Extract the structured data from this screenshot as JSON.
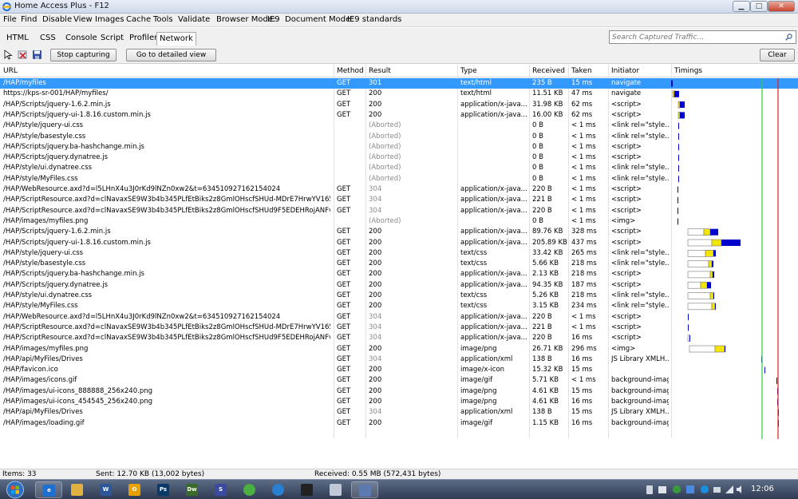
{
  "window": {
    "title": "Home Access Plus - F12"
  },
  "menu": [
    "File",
    "Find",
    "Disable",
    "View",
    "Images",
    "Cache",
    "Tools",
    "Validate"
  ],
  "browser_mode": {
    "label": "Browser Mode:",
    "value": "IE9"
  },
  "document_mode": {
    "label": "Document Mode:",
    "value": "IE9 standards"
  },
  "tabs": [
    "HTML",
    "CSS",
    "Console",
    "Script",
    "Profiler",
    "Network"
  ],
  "active_tab": "Network",
  "search": {
    "placeholder": "Search Captured Traffic..."
  },
  "toolbar": {
    "stop_label": "Stop capturing",
    "detail_label": "Go to detailed view",
    "clear_label": "Clear"
  },
  "columns": [
    "URL",
    "Method",
    "Result",
    "Type",
    "Received",
    "Taken",
    "Initiator",
    "Timings"
  ],
  "rows": [
    [
      "/HAP/myfiles",
      "GET",
      "301",
      "text/html",
      "235 B",
      "15 ms",
      "navigate"
    ],
    [
      "https://kps-sr-001/HAP/myfiles/",
      "GET",
      "200",
      "text/html",
      "11.51 KB",
      "47 ms",
      "navigate"
    ],
    [
      "/HAP/Scripts/jquery-1.6.2.min.js",
      "GET",
      "200",
      "application/x-java...",
      "31.98 KB",
      "62 ms",
      "<script>"
    ],
    [
      "/HAP/Scripts/jquery-ui-1.8.16.custom.min.js",
      "GET",
      "200",
      "application/x-java...",
      "16.00 KB",
      "62 ms",
      "<script>"
    ],
    [
      "/HAP/style/jquery-ui.css",
      "",
      "(Aborted)",
      "",
      "0 B",
      "< 1 ms",
      "<link rel=\"style..."
    ],
    [
      "/HAP/style/basestyle.css",
      "",
      "(Aborted)",
      "",
      "0 B",
      "< 1 ms",
      "<link rel=\"style..."
    ],
    [
      "/HAP/Scripts/jquery.ba-hashchange.min.js",
      "",
      "(Aborted)",
      "",
      "0 B",
      "< 1 ms",
      "<script>"
    ],
    [
      "/HAP/Scripts/jquery.dynatree.js",
      "",
      "(Aborted)",
      "",
      "0 B",
      "< 1 ms",
      "<script>"
    ],
    [
      "/HAP/style/ui.dynatree.css",
      "",
      "(Aborted)",
      "",
      "0 B",
      "< 1 ms",
      "<link rel=\"style..."
    ],
    [
      "/HAP/style/MyFiles.css",
      "",
      "(Aborted)",
      "",
      "0 B",
      "< 1 ms",
      "<link rel=\"style..."
    ],
    [
      "/HAP/WebResource.axd?d=l5LHnX4u3J0rKd9lNZn0xw2&t=634510927162154024",
      "GET",
      "304",
      "application/x-java...",
      "220 B",
      "< 1 ms",
      "<script>"
    ],
    [
      "/HAP/ScriptResource.axd?d=clNavaxSE9W3b4b345PLfEtBiks2z8GmlOHscfSHUd-MDrE7HrwYV1659LllL9W2...",
      "GET",
      "304",
      "application/x-java...",
      "221 B",
      "< 1 ms",
      "<script>"
    ],
    [
      "/HAP/ScriptResource.axd?d=clNavaxSE9W3b4b345PLfEtBiks2z8GmlOHscfSHUd9F5EDEHRojANFvBJ2PghR...",
      "GET",
      "304",
      "application/x-java...",
      "220 B",
      "< 1 ms",
      "<script>"
    ],
    [
      "/HAP/images/myfiles.png",
      "",
      "(Aborted)",
      "",
      "0 B",
      "< 1 ms",
      "<img>"
    ],
    [
      "/HAP/Scripts/jquery-1.6.2.min.js",
      "GET",
      "200",
      "application/x-java...",
      "89.76 KB",
      "328 ms",
      "<script>"
    ],
    [
      "/HAP/Scripts/jquery-ui-1.8.16.custom.min.js",
      "GET",
      "200",
      "application/x-java...",
      "205.89 KB",
      "437 ms",
      "<script>"
    ],
    [
      "/HAP/style/jquery-ui.css",
      "GET",
      "200",
      "text/css",
      "33.42 KB",
      "265 ms",
      "<link rel=\"style..."
    ],
    [
      "/HAP/style/basestyle.css",
      "GET",
      "200",
      "text/css",
      "5.66 KB",
      "218 ms",
      "<link rel=\"style..."
    ],
    [
      "/HAP/Scripts/jquery.ba-hashchange.min.js",
      "GET",
      "200",
      "application/x-java...",
      "2.13 KB",
      "218 ms",
      "<script>"
    ],
    [
      "/HAP/Scripts/jquery.dynatree.js",
      "GET",
      "200",
      "application/x-java...",
      "94.35 KB",
      "187 ms",
      "<script>"
    ],
    [
      "/HAP/style/ui.dynatree.css",
      "GET",
      "200",
      "text/css",
      "5.26 KB",
      "218 ms",
      "<link rel=\"style..."
    ],
    [
      "/HAP/style/MyFiles.css",
      "GET",
      "200",
      "text/css",
      "3.15 KB",
      "234 ms",
      "<link rel=\"style..."
    ],
    [
      "/HAP/WebResource.axd?d=l5LHnX4u3J0rKd9lNZn0xw2&t=634510927162154024",
      "GET",
      "304",
      "application/x-java...",
      "220 B",
      "< 1 ms",
      "<script>"
    ],
    [
      "/HAP/ScriptResource.axd?d=clNavaxSE9W3b4b345PLfEtBiks2z8GmlOHscfSHUd-MDrE7HrwYV1659LllL9W2...",
      "GET",
      "304",
      "application/x-java...",
      "221 B",
      "< 1 ms",
      "<script>"
    ],
    [
      "/HAP/ScriptResource.axd?d=clNavaxSE9W3b4b345PLfEtBiks2z8GmlOHscfSHUd9F5EDEHRojANFvBJ2PghR...",
      "GET",
      "304",
      "application/x-java...",
      "220 B",
      "16 ms",
      "<script>"
    ],
    [
      "/HAP/images/myfiles.png",
      "GET",
      "200",
      "image/png",
      "26.71 KB",
      "296 ms",
      "<img>"
    ],
    [
      "/HAP/api/MyFiles/Drives",
      "GET",
      "304",
      "application/xml",
      "138 B",
      "16 ms",
      "JS Library XMLH..."
    ],
    [
      "/HAP/favicon.ico",
      "GET",
      "200",
      "image/x-icon",
      "15.32 KB",
      "15 ms",
      ""
    ],
    [
      "/HAP/images/icons.gif",
      "GET",
      "200",
      "image/gif",
      "5.71 KB",
      "< 1 ms",
      "background-image"
    ],
    [
      "/HAP/images/ui-icons_888888_256x240.png",
      "GET",
      "200",
      "image/png",
      "4.61 KB",
      "15 ms",
      "background-image"
    ],
    [
      "/HAP/images/ui-icons_454545_256x240.png",
      "GET",
      "200",
      "image/png",
      "4.61 KB",
      "16 ms",
      "background-image"
    ],
    [
      "/HAP/api/MyFiles/Drives",
      "GET",
      "304",
      "application/xml",
      "138 B",
      "15 ms",
      "JS Library XMLH..."
    ],
    [
      "/HAP/images/loading.gif",
      "GET",
      "200",
      "image/gif",
      "1.15 KB",
      "16 ms",
      "background-image"
    ]
  ],
  "status": {
    "items": "Items: 33",
    "sent": "Sent: 12.70 KB (13,002 bytes)",
    "received": "Received: 0.55 MB (572,431 bytes)"
  },
  "taskbar": {
    "apps": [
      "ie-icon",
      "folder-icon",
      "word-icon",
      "outlook-icon",
      "photoshop-icon",
      "dreamweaver-icon",
      "sims-icon",
      "spotify-icon",
      "messenger-icon",
      "blackberry-icon",
      "paint-icon",
      "f12-icon"
    ],
    "clock": "12:06"
  },
  "colors": {
    "selection": "#3399ff",
    "bar_yellow": "#f2e600",
    "bar_blue": "#0000cc",
    "line_green": "#2ecc40",
    "line_red": "#e02020"
  }
}
